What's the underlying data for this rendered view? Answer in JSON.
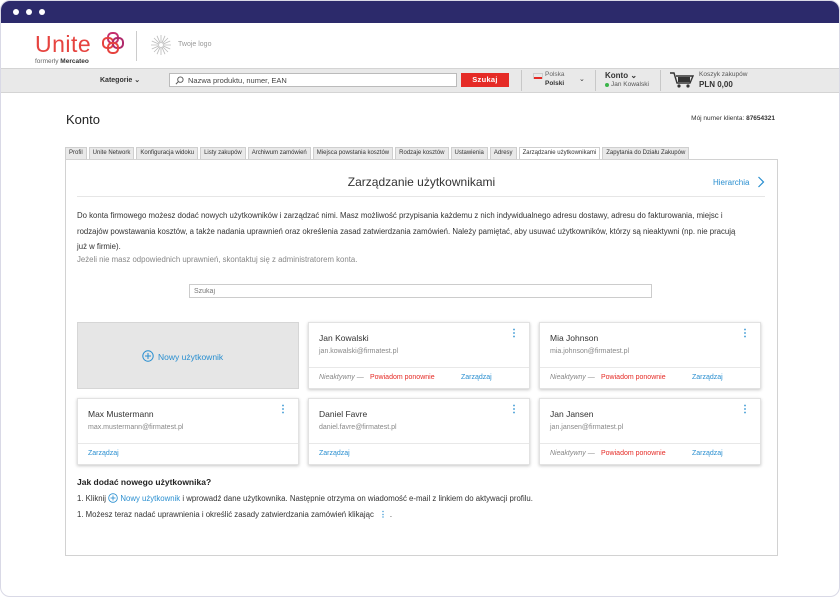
{
  "brand": {
    "logo": "Unite",
    "formerly_prefix": "formerly",
    "formerly_name": "Mercateo",
    "partner_logo_text": "Twoje logo"
  },
  "nav": {
    "categories": "Kategorie",
    "search_placeholder": "Nazwa produktu, numer, EAN",
    "search_button": "Szukaj",
    "country": "Polska",
    "language": "Polski",
    "account_title": "Konto",
    "account_user": "Jan Kowalski",
    "cart_label": "Koszyk zakupów",
    "cart_total": "PLN 0,00"
  },
  "page": {
    "title": "Konto",
    "client_label": "Mój numer klienta:",
    "client_number": "87654321"
  },
  "tabs": [
    {
      "label": "Profil"
    },
    {
      "label": "Unite Network"
    },
    {
      "label": "Konfiguracja widoku"
    },
    {
      "label": "Listy zakupów"
    },
    {
      "label": "Archiwum zamówień"
    },
    {
      "label": "Miejsca powstania kosztów"
    },
    {
      "label": "Rodzaje kosztów"
    },
    {
      "label": "Ustawienia"
    },
    {
      "label": "Adresy"
    },
    {
      "label": "Zarządzanie użytkownikami",
      "active": true
    },
    {
      "label": "Zapytania do Działu Zakupów"
    }
  ],
  "panel": {
    "title": "Zarządzanie użytkownikami",
    "hierarchy_link": "Hierarchia",
    "intro": "Do konta firmowego możesz dodać nowych użytkowników i zarządzać nimi. Masz możliwość przypisania każdemu z nich indywidualnego adresu dostawy, adresu do fakturowania, miejsc i rodzajów powstawania kosztów, a także nadania uprawnień oraz określenia zasad zatwierdzania zamówień. Należy pamiętać, aby usuwać użytkowników, którzy są nieaktywni (np. nie pracują już w firmie).",
    "note": "Jeżeli nie masz odpowiednich uprawnień, skontaktuj się z administratorem konta.",
    "filter_placeholder": "Szukaj",
    "new_user": "Nowy użytkownik"
  },
  "users": [
    {
      "name": "Jan Kowalski",
      "email": "jan.kowalski@firmatest.pl",
      "status": "Nieaktywny —",
      "resend": "Powiadom ponownie",
      "manage": "Zarządzaj"
    },
    {
      "name": "Mia Johnson",
      "email": "mia.johnson@firmatest.pl",
      "status": "Nieaktywny —",
      "resend": "Powiadom ponownie",
      "manage": "Zarządzaj"
    },
    {
      "name": "Max Mustermann",
      "email": "max.mustermann@firmatest.pl",
      "manage": "Zarządzaj"
    },
    {
      "name": "Daniel Favre",
      "email": "daniel.favre@firmatest.pl",
      "manage": "Zarządzaj"
    },
    {
      "name": "Jan Jansen",
      "email": "jan.jansen@firmatest.pl",
      "status": "Nieaktywny —",
      "resend": "Powiadom ponownie",
      "manage": "Zarządzaj"
    }
  ],
  "howto": {
    "title": "Jak dodać nowego użytkownika?",
    "step1_prefix": "1. Kliknij",
    "step1_link": "Nowy użytkownik",
    "step1_suffix": "i wprowadź dane użytkownika. Następnie otrzyma on wiadomość e-mail z linkiem do aktywacji profilu.",
    "step2_prefix": "1. Możesz teraz nadać uprawnienia i określić zasady zatwierdzania zamówień klikając",
    "step2_suffix": "."
  },
  "icons": {
    "search": "search-icon",
    "plus_circle": "plus-circle-icon",
    "kebab": "kebab-menu-icon",
    "cart": "cart-icon",
    "chevron": "chevron-right-icon"
  },
  "colors": {
    "accent": "#2a8fd0",
    "brand_red": "#e6433f",
    "titlebar": "#2c2a6b"
  }
}
